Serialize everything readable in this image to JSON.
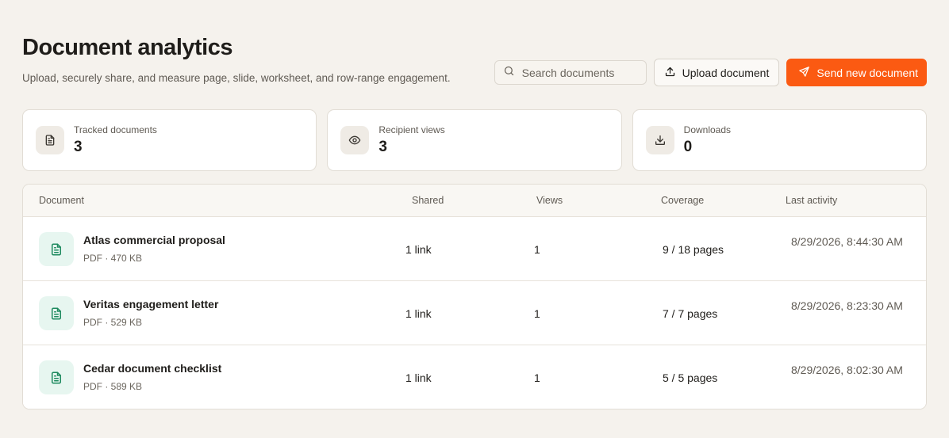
{
  "header": {
    "title": "Document analytics",
    "subtitle": "Upload, securely share, and measure page, slide, worksheet, and row-range engagement."
  },
  "actions": {
    "search_placeholder": "Search documents",
    "upload_label": "Upload document",
    "send_label": "Send new document"
  },
  "stats": [
    {
      "label": "Tracked documents",
      "value": "3",
      "icon": "file-text-icon"
    },
    {
      "label": "Recipient views",
      "value": "3",
      "icon": "eye-icon"
    },
    {
      "label": "Downloads",
      "value": "0",
      "icon": "download-icon"
    }
  ],
  "table": {
    "columns": [
      "Document",
      "Shared",
      "Views",
      "Coverage",
      "Last activity"
    ],
    "rows": [
      {
        "name": "Atlas commercial proposal",
        "meta": "PDF · 470 KB",
        "shared": "1 link",
        "views": "1",
        "coverage": "9 / 18 pages",
        "last_activity": "8/29/2026, 8:44:30 AM"
      },
      {
        "name": "Veritas engagement letter",
        "meta": "PDF · 529 KB",
        "shared": "1 link",
        "views": "1",
        "coverage": "7 / 7 pages",
        "last_activity": "8/29/2026, 8:23:30 AM"
      },
      {
        "name": "Cedar document checklist",
        "meta": "PDF · 589 KB",
        "shared": "1 link",
        "views": "1",
        "coverage": "5 / 5 pages",
        "last_activity": "8/29/2026, 8:02:30 AM"
      }
    ]
  },
  "colors": {
    "accent": "#fb5a12",
    "doc_icon_bg": "#e7f6f0",
    "doc_icon_fg": "#1e8a5f",
    "background": "#f5f2ed"
  }
}
